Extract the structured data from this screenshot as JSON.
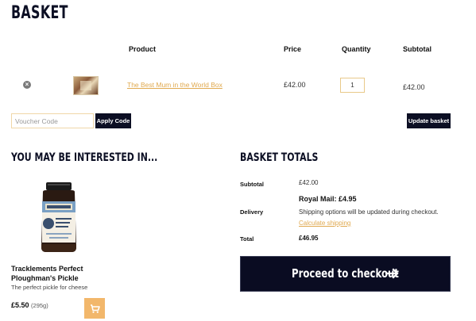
{
  "page": {
    "title": "BASKET"
  },
  "table": {
    "headers": {
      "product": "Product",
      "price": "Price",
      "quantity": "Quantity",
      "subtotal": "Subtotal"
    },
    "row": {
      "remove_symbol": "×",
      "product_name": "The Best Mum in the World Box",
      "price": "£42.00",
      "quantity": "1",
      "subtotal": "£42.00"
    }
  },
  "coupon": {
    "placeholder": "Voucher Code",
    "apply_label": "Apply Code"
  },
  "update_label": "Update basket",
  "upsell": {
    "title": "YOU MAY BE INTERESTED IN...",
    "product": {
      "name": "Tracklements Perfect Ploughman's Pickle",
      "description": "The perfect pickle for cheese",
      "price": "£5.50",
      "weight": "(295g)"
    }
  },
  "totals": {
    "title": "BASKET TOTALS",
    "subtotal_label": "Subtotal",
    "subtotal_value": "£42.00",
    "shipping_method": "Royal Mail: £4.95",
    "delivery_label": "Delivery",
    "delivery_note": "Shipping options will be updated during checkout.",
    "calculate_link": "Calculate shipping",
    "total_label": "Total",
    "total_value": "£46.95"
  },
  "checkout": {
    "label": "Proceed to checkout"
  },
  "colors": {
    "navy": "#0c0f24",
    "accent": "#e0a94f",
    "cart_button": "#f2b76b"
  },
  "icons": [
    "remove-icon",
    "cart-icon",
    "arrow-right-icon"
  ]
}
